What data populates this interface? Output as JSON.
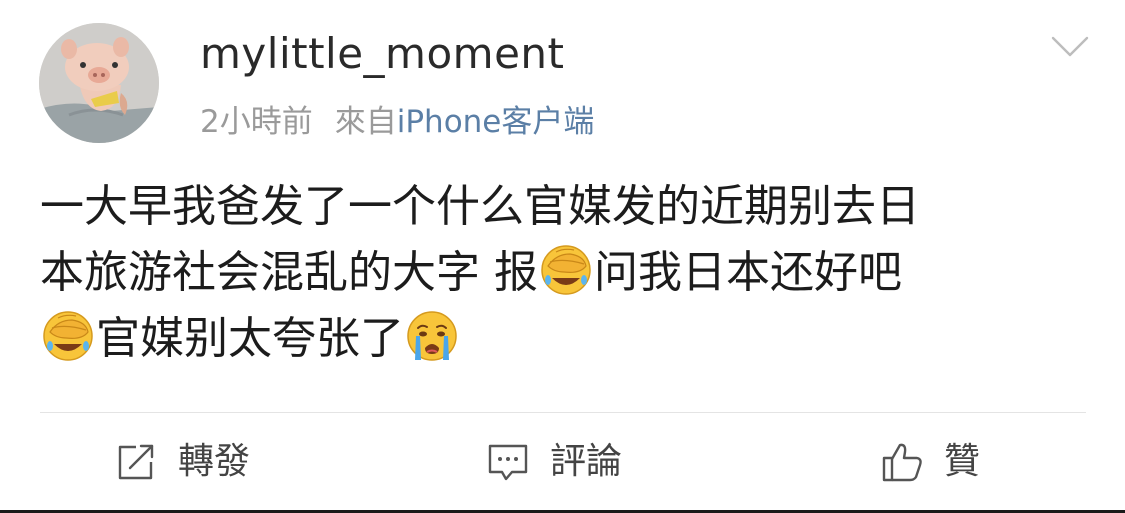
{
  "post": {
    "username": "mylittle_moment",
    "time": "2小時前",
    "source_prefix": "來自",
    "source_name": "iPhone客户端",
    "content": {
      "line1": "一大早我爸发了一个什么官媒发的近期别去日",
      "line2_a": "本旅游社会混乱的大字 报",
      "line2_b": "问我日本还好吧",
      "line3_a": "官媒别太夸张了"
    },
    "emojis": [
      "facepalm-laugh-emoji",
      "facepalm-laugh-emoji",
      "crying-emoji"
    ]
  },
  "actions": {
    "repost_label": "轉發",
    "comment_label": "評論",
    "like_label": "贊"
  },
  "icons": [
    "chevron-down-icon",
    "repost-icon",
    "comment-icon",
    "thumbs-up-icon"
  ],
  "colors": {
    "meta_gray": "#9a9a9a",
    "source_link": "#5b7fa6",
    "emoji_yellow": "#f8c53a"
  }
}
